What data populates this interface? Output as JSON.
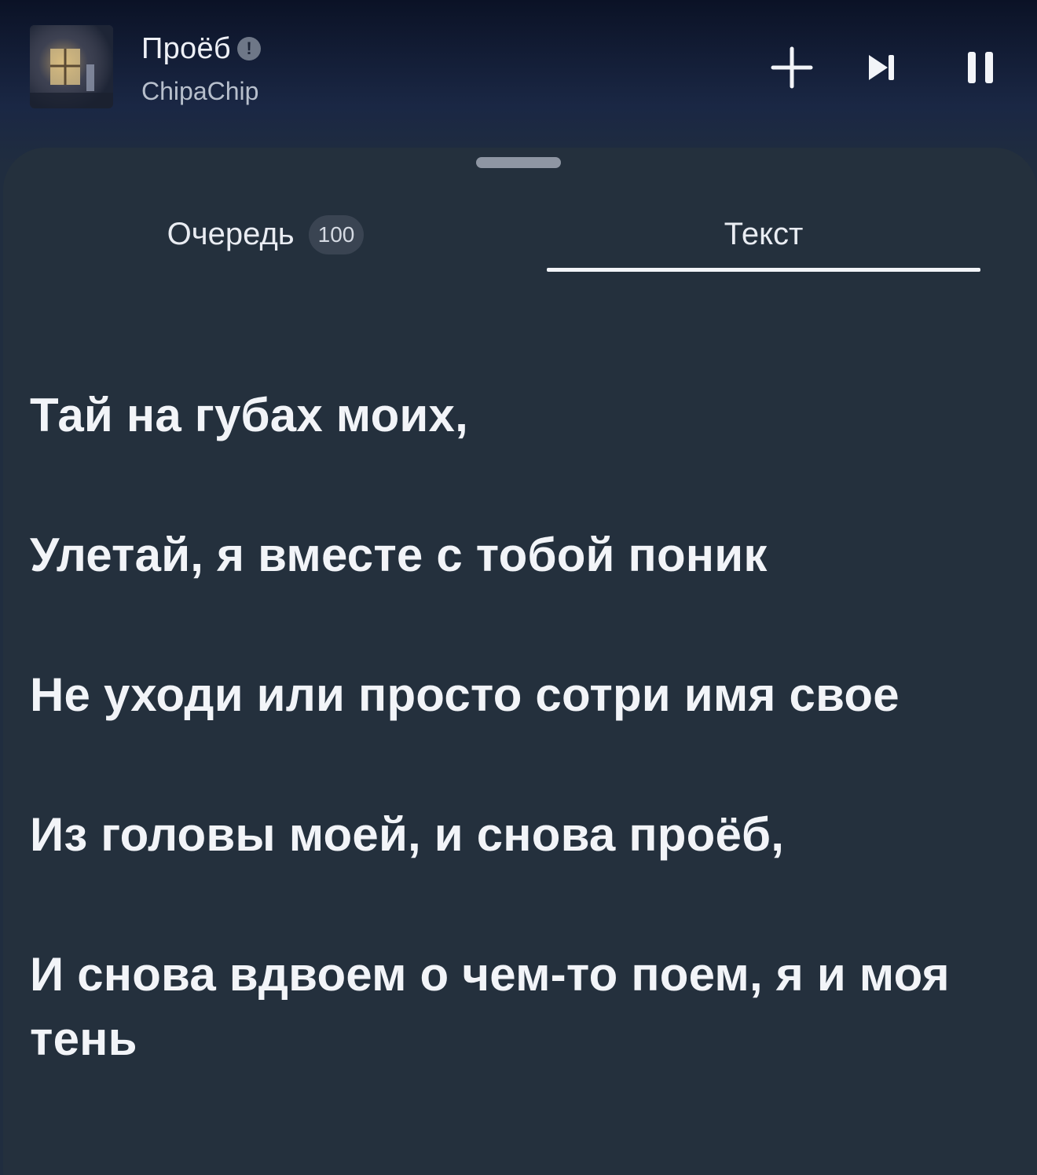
{
  "player": {
    "title": "Проёб",
    "explicit_mark": "!",
    "artist": "ChipaChip",
    "controls": {
      "add_icon": "plus-icon",
      "next_icon": "skip-next-icon",
      "pause_icon": "pause-icon"
    }
  },
  "tabs": {
    "queue_label": "Очередь",
    "queue_count": "100",
    "lyrics_label": "Текст",
    "active": "lyrics"
  },
  "lyrics": {
    "lines": [
      "Тай на губах моих,",
      "Улетай, я вместе с тобой поник",
      "Не уходи или просто сотри имя свое",
      "Из головы моей, и снова проёб,",
      "И снова вдвоем о чем-то поем, я и моя тень"
    ]
  },
  "colors": {
    "sheet_background": "#24303d",
    "text_primary": "#f2f4f8",
    "text_secondary": "#b7bfcc"
  }
}
